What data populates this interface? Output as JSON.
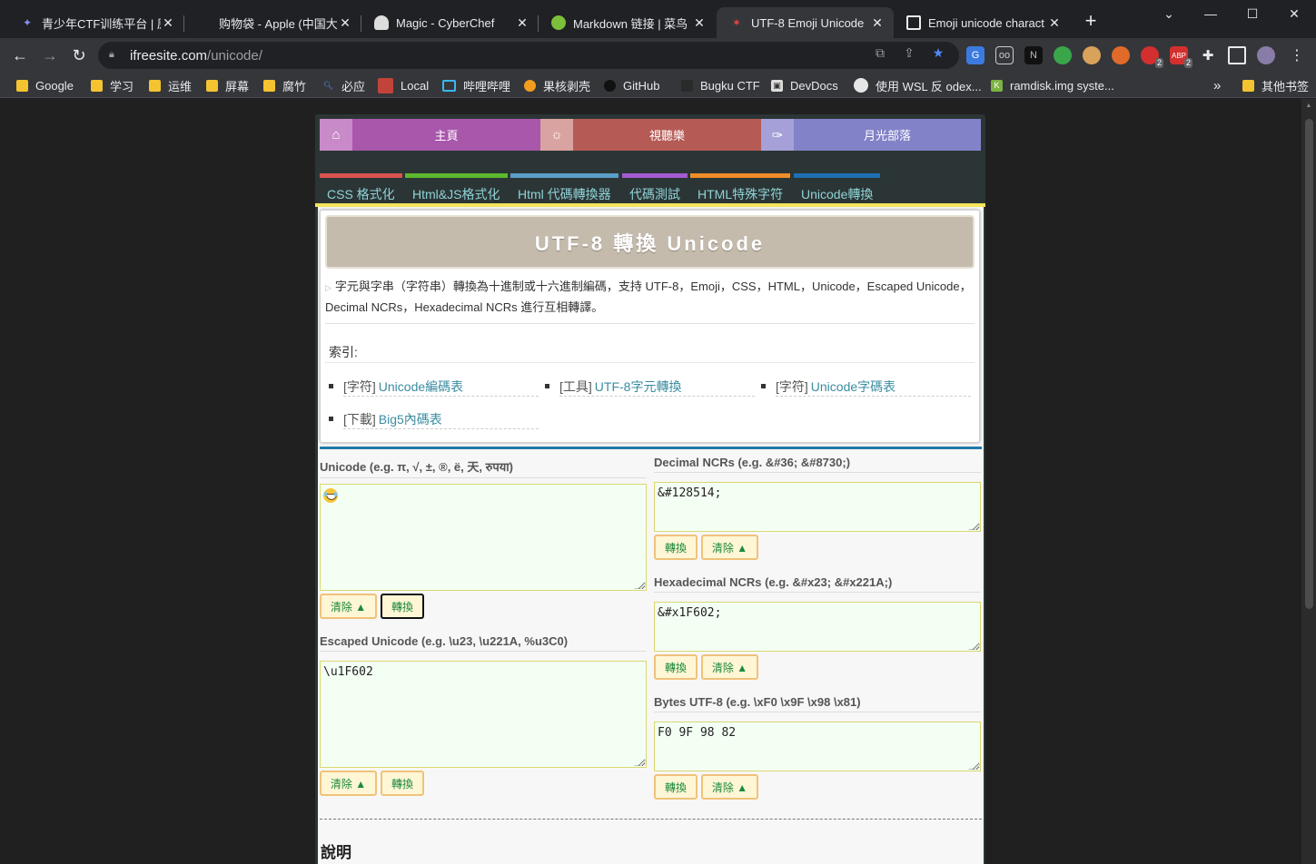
{
  "browser": {
    "tabs": [
      {
        "title": "青少年CTF训练平台 | 原",
        "favicon": "ctf-favicon",
        "color": "#6b6bd6"
      },
      {
        "title": "购物袋 - Apple (中国大",
        "favicon": "apple-favicon",
        "color": "#aaaaaa"
      },
      {
        "title": "Magic - CyberChef",
        "favicon": "cyberchef-favicon",
        "color": "#dddddd"
      },
      {
        "title": "Markdown 链接 | 菜鸟",
        "favicon": "runoob-favicon",
        "color": "#7bbf3a"
      },
      {
        "title": "UTF-8 Emoji Unicode",
        "favicon": "ifreesite-favicon",
        "color": "#d23"
      },
      {
        "title": "Emoji unicode charact",
        "favicon": "unicode-favicon",
        "color": "#ffffff"
      }
    ],
    "window_controls": {
      "minimize": "—",
      "maximize": "☐",
      "close": "✕",
      "dropdown": "⌄"
    },
    "url_host": "ifreesite.com",
    "url_path": "/unicode/",
    "bookmarks": [
      {
        "label": "Google",
        "icon": "folder-icon"
      },
      {
        "label": "学习",
        "icon": "folder-icon"
      },
      {
        "label": "运维",
        "icon": "folder-icon"
      },
      {
        "label": "屏幕",
        "icon": "folder-icon"
      },
      {
        "label": "腐竹",
        "icon": "folder-icon"
      },
      {
        "label": "必应",
        "icon": "bing-icon"
      },
      {
        "label": "Local",
        "icon": "local-icon"
      },
      {
        "label": "哔哩哔哩",
        "icon": "bilibili-icon"
      },
      {
        "label": "果核剥壳",
        "icon": "guohe-icon"
      },
      {
        "label": "GitHub",
        "icon": "github-icon"
      },
      {
        "label": "Bugku CTF",
        "icon": "bugku-icon"
      },
      {
        "label": "DevDocs",
        "icon": "devdocs-icon"
      },
      {
        "label": "使用 WSL 反 odex...",
        "icon": "wsl-icon"
      },
      {
        "label": "ramdisk.img syste...",
        "icon": "ramdisk-icon"
      }
    ],
    "bookmarks_more": "»",
    "other_bookmarks": "其他书签"
  },
  "site": {
    "topnav": {
      "home": "主頁",
      "media": "視聽樂",
      "blog": "月光部落"
    },
    "subnav": [
      {
        "label": "CSS 格式化",
        "color": "#d9534f"
      },
      {
        "label": "Html&JS格式化",
        "color": "#5cb82f"
      },
      {
        "label": "Html 代碼轉換器",
        "color": "#5a9ec8"
      },
      {
        "label": "代碼測試",
        "color": "#a45bd0"
      },
      {
        "label": "HTML特殊字符",
        "color": "#f08c2a"
      },
      {
        "label": "Unicode轉換",
        "color": "#1e6fb3"
      }
    ],
    "title": "UTF-8 轉換 Unicode",
    "description": "字元與字串（字符串）轉換為十進制或十六進制編碼，支持 UTF-8，Emoji，CSS，HTML，Unicode，Escaped Unicode，Decimal NCRs，Hexadecimal NCRs 進行互相轉譯。",
    "index_label": "索引:",
    "index": [
      {
        "cat": "[字符]",
        "link": "Unicode編碼表"
      },
      {
        "cat": "[工具]",
        "link": "UTF-8字元轉換"
      },
      {
        "cat": "[字符]",
        "link": "Unicode字碼表"
      },
      {
        "cat": "[下載]",
        "link": "Big5內碼表"
      }
    ],
    "unicode": {
      "label": "Unicode (e.g. π, √, ±, ®, ë, 天, रुपया)",
      "value": "😂"
    },
    "escaped": {
      "label": "Escaped Unicode (e.g. \\u23, \\u221A, %u3C0)",
      "value": "\\u1F602"
    },
    "decimal": {
      "label": "Decimal NCRs (e.g. &#36; &#8730;)",
      "value": "&#128514;"
    },
    "hex": {
      "label": "Hexadecimal NCRs (e.g. &#x23; &#x221A;)",
      "value": "&#x1F602;"
    },
    "bytes": {
      "label": "Bytes UTF-8 (e.g. \\xF0 \\x9F \\x98 \\x81)",
      "value": "F0 9F 98 82"
    },
    "buttons": {
      "clear": "清除 ▲",
      "convert": "轉換"
    },
    "section_heading": "說明"
  }
}
